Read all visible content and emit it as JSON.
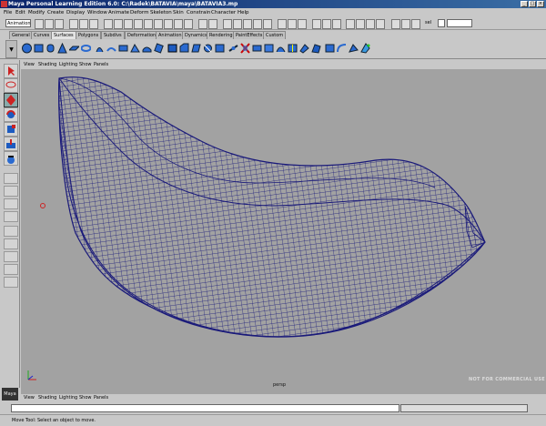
{
  "window": {
    "title": "Maya Personal Learning Edition 6.0: C:\\Radek\\BATAVIA\\maya\\BATAVIA3.mp",
    "controls": [
      "_",
      "□",
      "×"
    ]
  },
  "menubar": [
    "File",
    "Edit",
    "Modify",
    "Create",
    "Display",
    "Window",
    "Animate",
    "Deform",
    "Skeleton",
    "Skin",
    "Constrain",
    "Character",
    "Help"
  ],
  "toolbar": {
    "mode": "Animation",
    "sel_label": "sel"
  },
  "shelf": {
    "tabs": [
      "General",
      "Curves",
      "Surfaces",
      "Polygons",
      "Subdivs",
      "Deformation",
      "Animation",
      "Dynamics",
      "Rendering",
      "PaintEffects",
      "Custom"
    ],
    "active_tab": "Surfaces"
  },
  "panel_menu": [
    "View",
    "Shading",
    "Lighting",
    "Show",
    "Panels"
  ],
  "viewport": {
    "camera": "persp",
    "watermark": "NOT FOR COMMERCIAL USE"
  },
  "logo": "Maya",
  "helpline": "Move Tool: Select an object to move.",
  "colors": {
    "wireframe": "#1a1a7a",
    "viewport_bg": "#a2a2a2",
    "title_bg": "#0a246a"
  }
}
